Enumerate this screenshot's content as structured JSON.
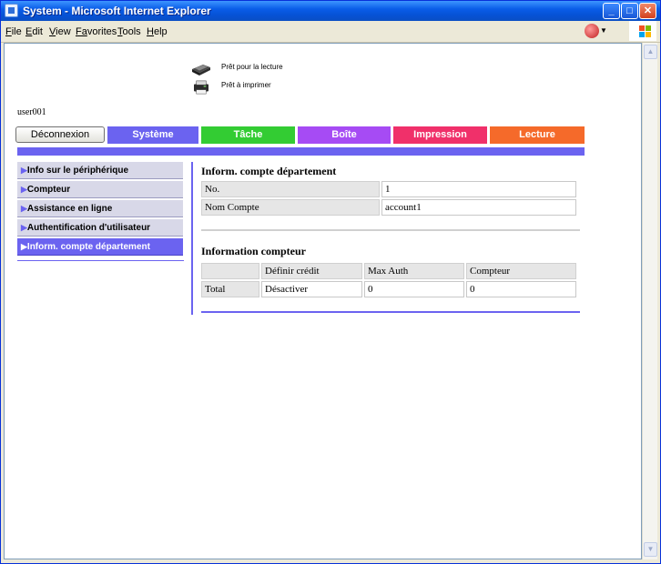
{
  "window": {
    "title": "System - Microsoft Internet Explorer",
    "buttons": {
      "minimize": "_",
      "maximize": "□",
      "close": "✕"
    }
  },
  "menubar": {
    "items": [
      {
        "first": "F",
        "rest": "ile"
      },
      {
        "first": "E",
        "rest": "dit"
      },
      {
        "first": "V",
        "rest": "iew"
      },
      {
        "first": "Fa",
        "rest": "vorites"
      },
      {
        "first": "T",
        "rest": "ools"
      },
      {
        "first": "H",
        "rest": "elp"
      }
    ]
  },
  "status": {
    "read": "Prêt pour la lecture",
    "print": "Prêt à imprimer"
  },
  "user": {
    "name": "user001"
  },
  "nav": {
    "logout": "Déconnexion",
    "tabs": [
      {
        "label": "Système",
        "color": "#6b63f0"
      },
      {
        "label": "Tâche",
        "color": "#33cc33"
      },
      {
        "label": "Boîte",
        "color": "#a64bf4"
      },
      {
        "label": "Impression",
        "color": "#f0306a"
      },
      {
        "label": "Lecture",
        "color": "#f56a2a"
      }
    ]
  },
  "sidebar": {
    "arrow": "▶",
    "items": [
      {
        "label": "Info sur le périphérique",
        "active": false
      },
      {
        "label": "Compteur",
        "active": false
      },
      {
        "label": "Assistance en ligne",
        "active": false
      },
      {
        "label": "Authentification d'utilisateur",
        "active": false
      },
      {
        "label": "Inform. compte département",
        "active": true
      }
    ]
  },
  "account_info": {
    "title": "Inform. compte département",
    "rows": [
      {
        "label": "No.",
        "value": "1"
      },
      {
        "label": "Nom Compte",
        "value": "account1"
      }
    ]
  },
  "counter_info": {
    "title": "Information compteur",
    "headers": [
      "",
      "Définir crédit",
      "Max Auth",
      "Compteur"
    ],
    "rows": [
      {
        "label": "Total",
        "credit": "Désactiver",
        "max_auth": "0",
        "counter": "0"
      }
    ]
  },
  "colors": {
    "accent": "#6b63f0",
    "xp_titlebar": "#0a5de8"
  }
}
